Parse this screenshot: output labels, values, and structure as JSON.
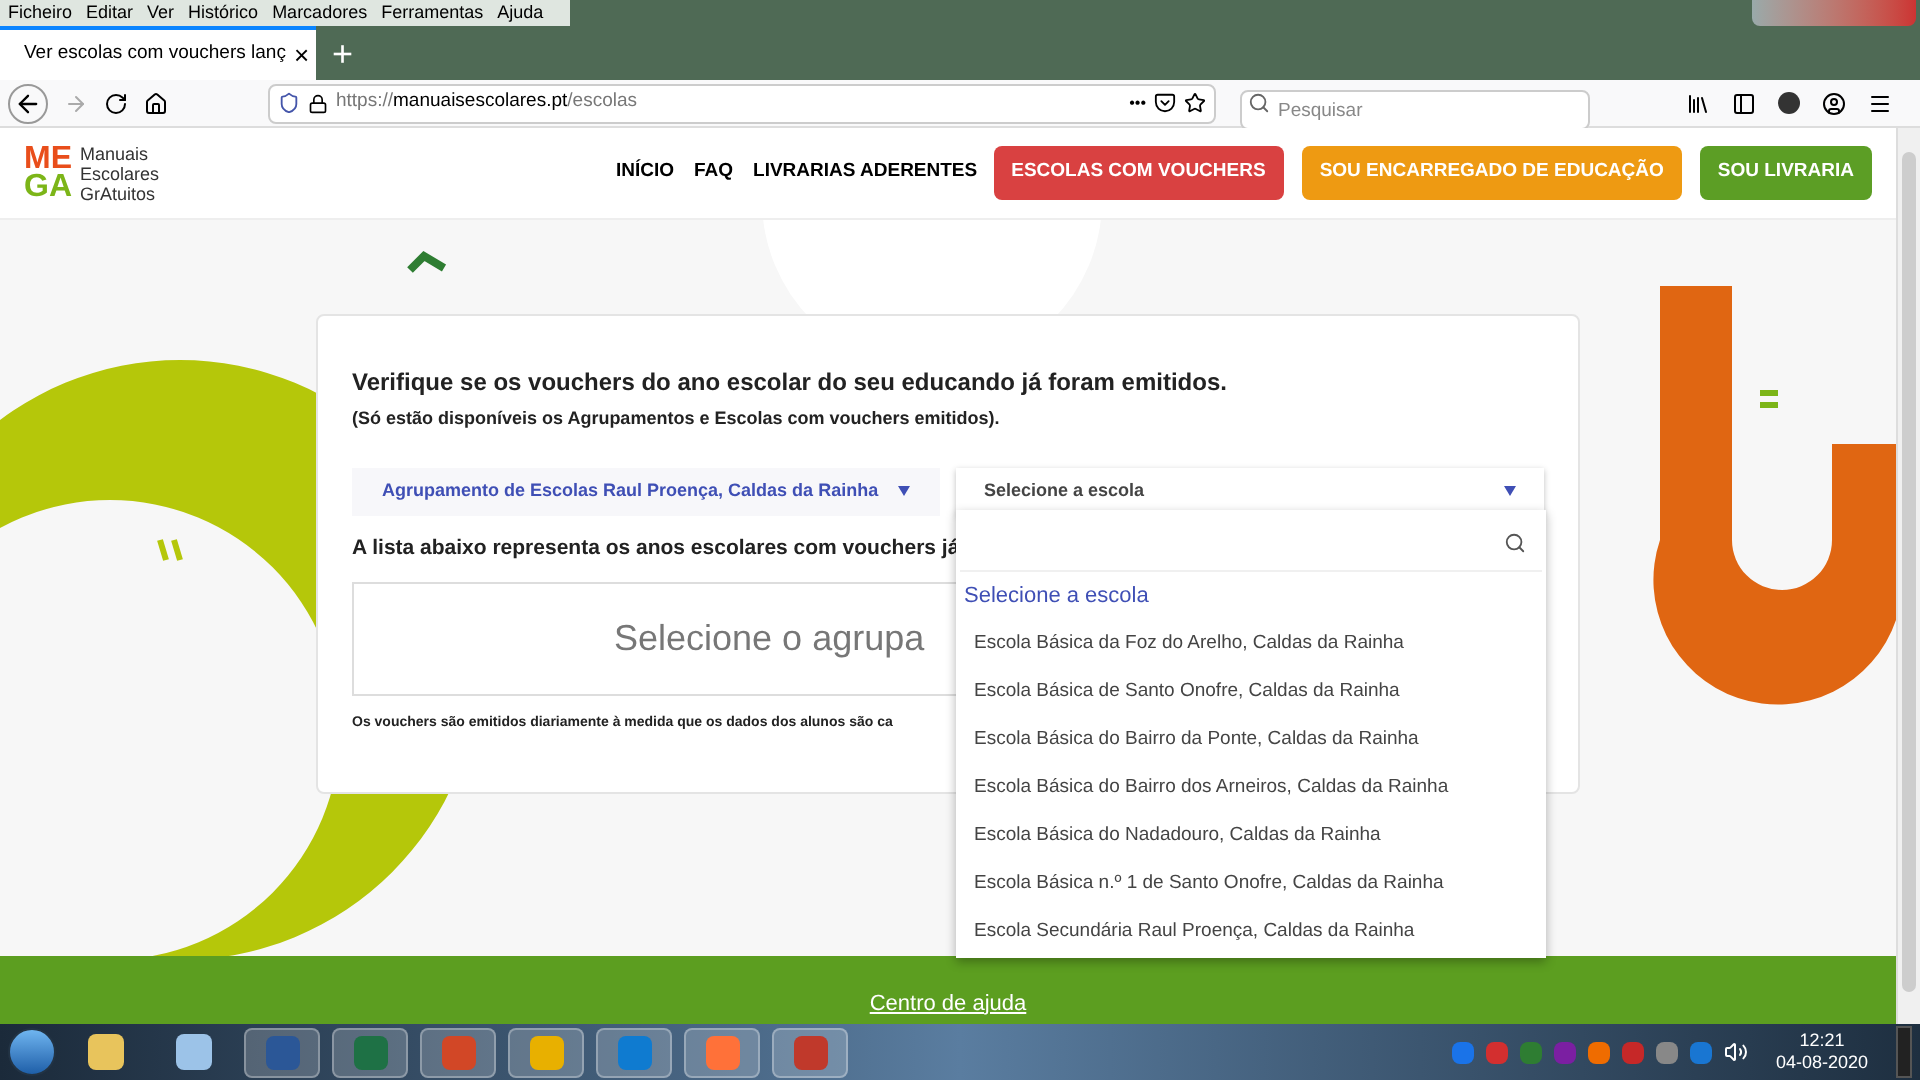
{
  "menu_bar": [
    "Ficheiro",
    "Editar",
    "Ver",
    "Histórico",
    "Marcadores",
    "Ferramentas",
    "Ajuda"
  ],
  "browser_tab": {
    "title": "Ver escolas com vouchers lanç",
    "close": "×",
    "new_tab": "+"
  },
  "address_bar": {
    "url_prefix": "https://",
    "url_domain": "manuaisescolares.pt",
    "url_path": "/escolas",
    "more": "•••"
  },
  "search": {
    "placeholder": "Pesquisar"
  },
  "logo": {
    "letters_top": "ME",
    "letters_bottom": "GA",
    "line1": "Manuais",
    "line2": "Escolares",
    "line3": "GrAtuitos"
  },
  "nav": {
    "links": [
      "INÍCIO",
      "FAQ",
      "LIVRARIAS ADERENTES"
    ],
    "buttons": [
      {
        "label": "ESCOLAS COM VOUCHERS",
        "color": "#d94141"
      },
      {
        "label": "SOU ENCARREGADO DE EDUCAÇÃO",
        "color": "#ee9a12"
      },
      {
        "label": "SOU LIVRARIA",
        "color": "#5c9e25"
      }
    ]
  },
  "card": {
    "heading": "Verifique se os vouchers do ano escolar do seu educando já foram emitidos.",
    "subheading": "(Só estão disponíveis os Agrupamentos e Escolas com vouchers emitidos).",
    "group_select": {
      "value": "Agrupamento de Escolas Raul Proença, Caldas da Rainha"
    },
    "school_select": {
      "value": "Selecione a escola",
      "expanded": true
    },
    "list_heading": "A lista abaixo representa os anos escolares com vouchers já",
    "placeholder_box": "Selecione o agrupa",
    "footnote": "Os vouchers são emitidos diariamente à medida que os dados dos alunos são ca"
  },
  "dropdown": {
    "header": "Selecione a escola",
    "options": [
      "Escola Básica da Foz do Arelho, Caldas da Rainha",
      "Escola Básica de Santo Onofre, Caldas da Rainha",
      "Escola Básica do Bairro da Ponte, Caldas da Rainha",
      "Escola Básica do Bairro dos Arneiros, Caldas da Rainha",
      "Escola Básica do Nadadouro, Caldas da Rainha",
      "Escola Básica n.º 1 de Santo Onofre, Caldas da Rainha",
      "Escola Secundária Raul Proença, Caldas da Rainha"
    ]
  },
  "footer": {
    "link": "Centro de ajuda"
  },
  "taskbar": {
    "time": "12:21",
    "date": "04-08-2020"
  }
}
